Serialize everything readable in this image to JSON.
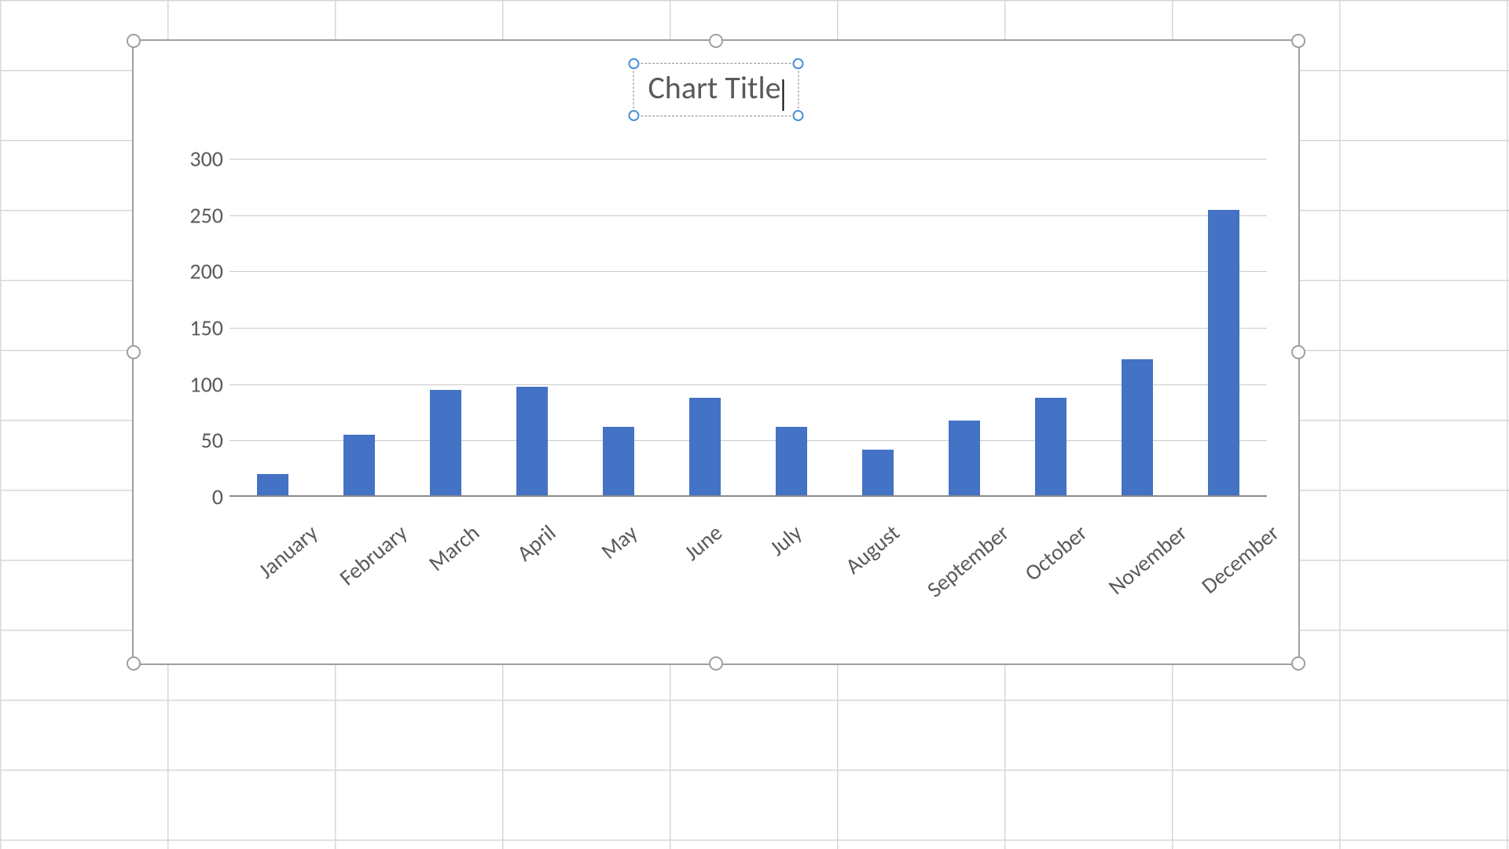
{
  "chart_data": {
    "type": "bar",
    "title": "Chart Title",
    "categories": [
      "January",
      "February",
      "March",
      "April",
      "May",
      "June",
      "July",
      "August",
      "September",
      "October",
      "November",
      "December"
    ],
    "values": [
      20,
      55,
      95,
      98,
      62,
      88,
      62,
      42,
      68,
      88,
      122,
      255
    ],
    "xlabel": "",
    "ylabel": "",
    "ylim": [
      0,
      300
    ],
    "y_ticks": [
      0,
      50,
      100,
      150,
      200,
      250,
      300
    ],
    "bar_color": "#4472c4",
    "grid": true
  },
  "ui": {
    "title_selected": true,
    "title_editing": true,
    "chart_selected": true
  }
}
